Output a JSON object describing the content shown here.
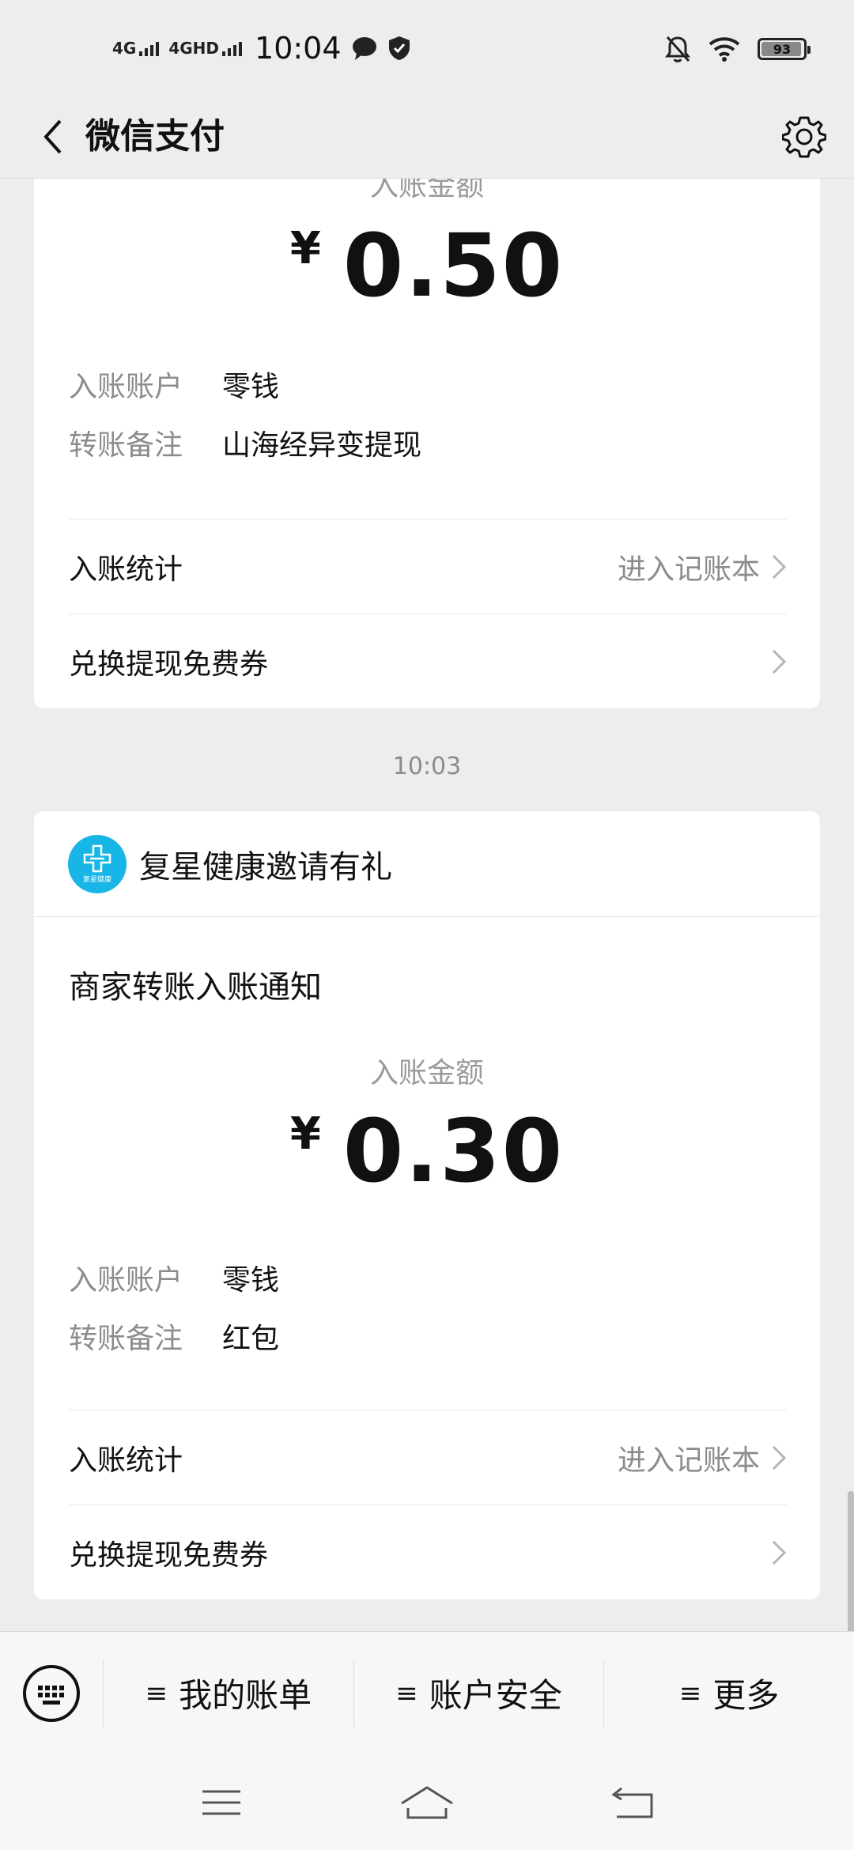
{
  "status_bar": {
    "network1": "4G",
    "network2": "4GHD",
    "time": "10:04",
    "battery": "93"
  },
  "nav": {
    "title": "微信支付"
  },
  "card1": {
    "amount_label_partial": "入账金额",
    "currency": "¥",
    "amount": "0.50",
    "account_label": "入账账户",
    "account_value": "零钱",
    "memo_label": "转账备注",
    "memo_value": "山海经异变提现",
    "stats_label": "入账统计",
    "stats_link": "进入记账本",
    "coupon_label": "兑换提现免费券"
  },
  "timestamp": "10:03",
  "card2": {
    "merchant_name": "复星健康邀请有礼",
    "logo_text": "复星健康",
    "notice_title": "商家转账入账通知",
    "amount_label": "入账金额",
    "currency": "¥",
    "amount": "0.30",
    "account_label": "入账账户",
    "account_value": "零钱",
    "memo_label": "转账备注",
    "memo_value": "红包",
    "stats_label": "入账统计",
    "stats_link": "进入记账本",
    "coupon_label": "兑换提现免费券"
  },
  "bottom_menu": {
    "items": [
      {
        "label": "我的账单"
      },
      {
        "label": "账户安全"
      },
      {
        "label": "更多"
      }
    ]
  }
}
